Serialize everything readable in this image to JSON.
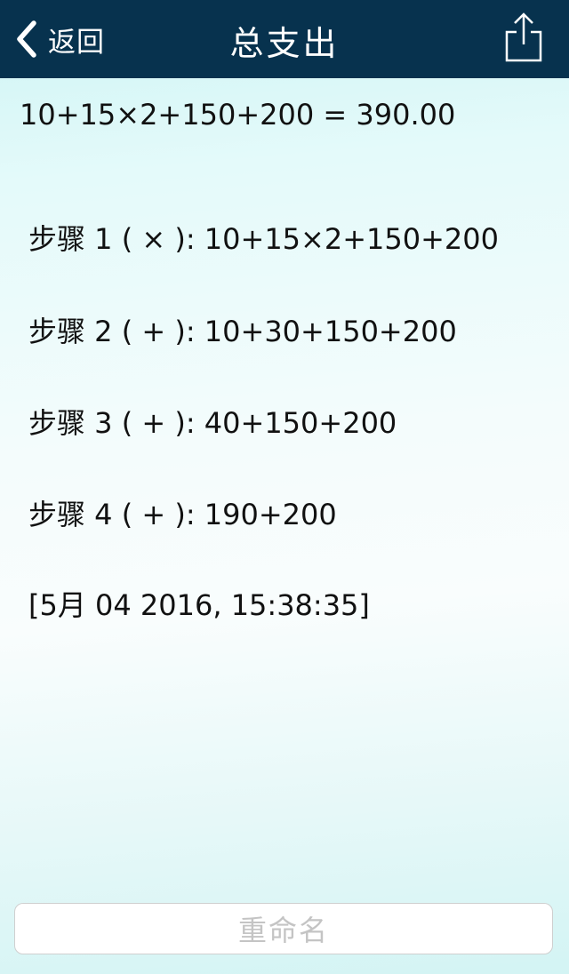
{
  "nav": {
    "back_label": "返回",
    "title": "总支出",
    "back_icon": "chevron-left-icon",
    "share_icon": "share-icon"
  },
  "calculation": {
    "result": "10+15×2+150+200 = 390.00",
    "steps": [
      "步骤 1 ( × ): 10+15×2+150+200",
      "步骤 2 ( + ): 10+30+150+200",
      "步骤 3 ( + ): 40+150+200",
      "步骤 4 ( + ): 190+200"
    ],
    "timestamp": "[5月 04 2016, 15:38:35]"
  },
  "footer": {
    "rename_label": "重命名"
  },
  "colors": {
    "nav_background": "#07324e",
    "nav_text": "#ffffff",
    "content_text": "#111111",
    "button_text_disabled": "#c4c4c4"
  }
}
